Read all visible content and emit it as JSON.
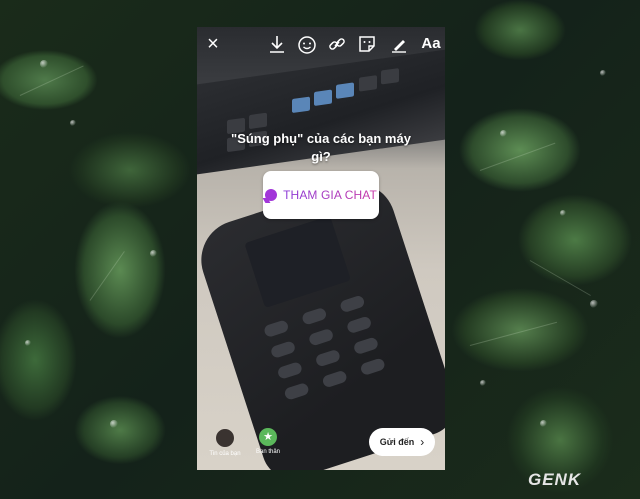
{
  "story": {
    "toolbar": {
      "close_icon": "×",
      "text_tool_label": "Aa"
    },
    "question_line1": "\"Súng phụ\" của các bạn máy",
    "question_line2": "gì?",
    "sticker": {
      "label": "THAM GIA CHAT",
      "accent_color": "#a236d9"
    },
    "bottom": {
      "your_story_label": "Tin của bạn",
      "close_friends_label": "Bạn thân",
      "close_friends_icon": "★",
      "send_label": "Gửi đến",
      "send_chevron": "›"
    }
  },
  "watermark": "GENK"
}
